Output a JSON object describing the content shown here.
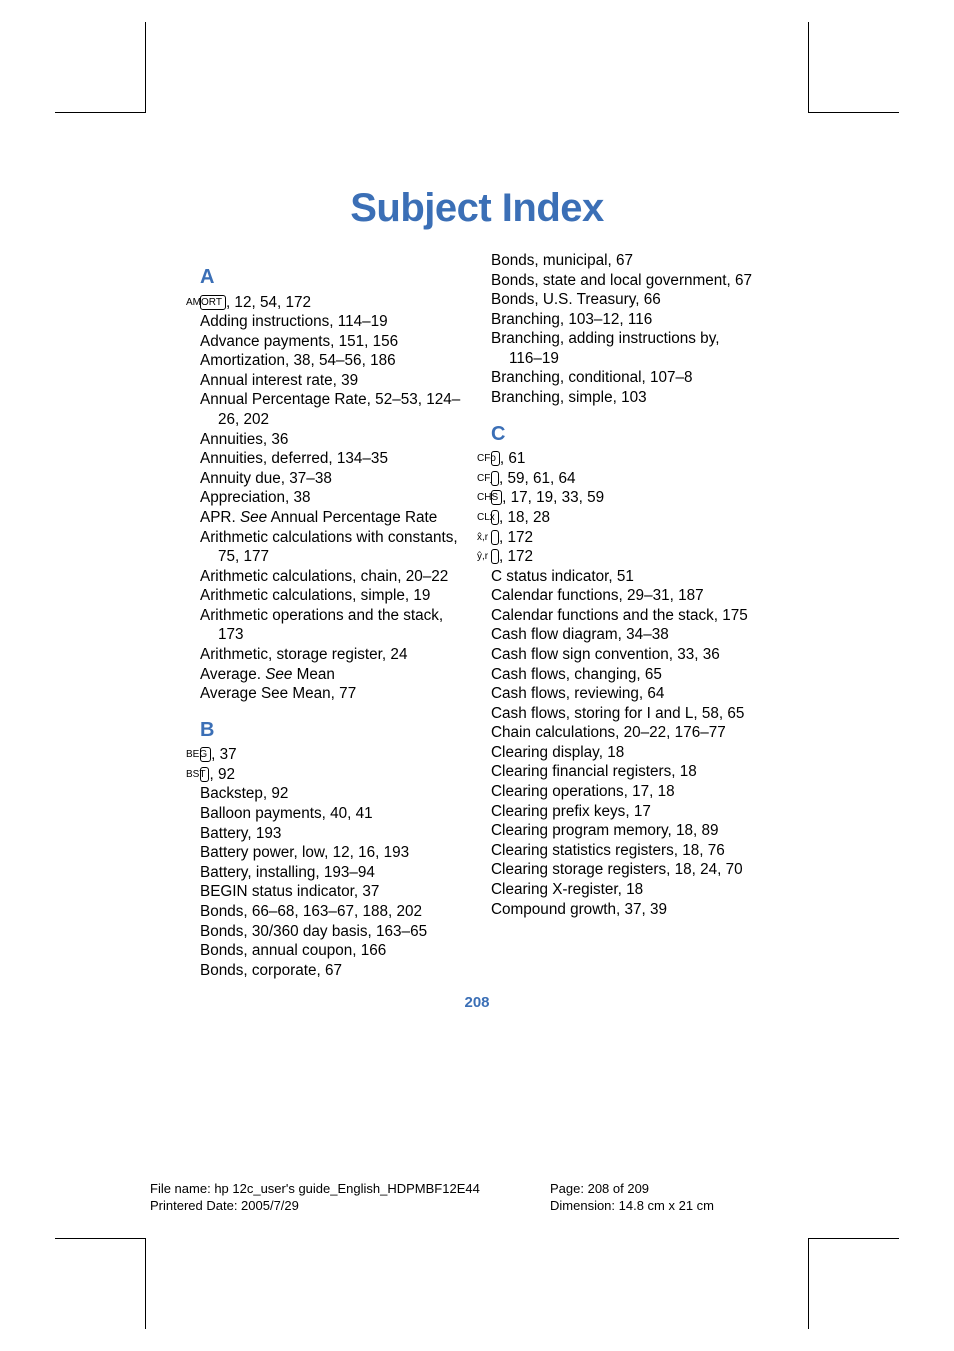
{
  "title": "Subject Index",
  "page_number": "208",
  "footer": {
    "filename_label": "File name: ",
    "filename": "hp 12c_user's guide_English_HDPMBF12E44",
    "date_label": "Printered Date: ",
    "date": "2005/7/29",
    "page_label": "Page: ",
    "page": "208 of 209",
    "dim_label": "Dimension: ",
    "dim": "14.8 cm x 21 cm"
  },
  "A": {
    "heading": "A",
    "amort_key": "AMORT",
    "amort_pages": ", 12, 54, 172",
    "e1": "Adding instructions, 114–19",
    "e2": "Advance payments, 151, 156",
    "e3": "Amortization, 38, 54–56, 186",
    "e4": "Annual interest rate, 39",
    "e5": "Annual Percentage Rate, 52–53, 124–26, 202",
    "e6": "Annuities, 36",
    "e7": "Annuities, deferred, 134–35",
    "e8": "Annuity due, 37–38",
    "e9": "Appreciation, 38",
    "e10_a": "APR. ",
    "e10_b": "See",
    "e10_c": " Annual Percentage Rate",
    "e11": "Arithmetic calculations with constants, 75, 177",
    "e12": "Arithmetic calculations, chain, 20–22",
    "e13": "Arithmetic calculations, simple, 19",
    "e14": "Arithmetic operations and the stack, 173",
    "e15": "Arithmetic, storage register, 24",
    "e16_a": "Average. ",
    "e16_b": "See",
    "e16_c": " Mean",
    "e17": "Average See Mean, 77"
  },
  "B": {
    "heading": "B",
    "beg_key": "BEG",
    "beg_pages": ", 37",
    "bst_key": "BST",
    "bst_pages": ", 92",
    "e1": "Backstep, 92",
    "e2": "Balloon payments, 40, 41",
    "e3": "Battery, 193",
    "e4": "Battery power, low, 12, 16, 193",
    "e5": "Battery, installing, 193–94",
    "e6": "BEGIN status indicator, 37",
    "e7": "Bonds, 66–68, 163–67, 188, 202",
    "e8": "Bonds, 30/360 day basis, 163–65",
    "e9": "Bonds, annual coupon, 166",
    "e10": "Bonds, corporate, 67"
  },
  "B2": {
    "e11": "Bonds, municipal, 67",
    "e12": "Bonds, state and local government, 67",
    "e13": "Bonds, U.S. Treasury, 66",
    "e14": "Branching, 103–12, 116",
    "e15": "Branching, adding instructions by, 116–19",
    "e16": "Branching, conditional, 107–8",
    "e17": "Branching, simple, 103"
  },
  "C": {
    "heading": "C",
    "cfo_key": "CFo",
    "cfo_pages": ", 61",
    "cfj_key": "CFj",
    "cfj_pages": ", 59, 61, 64",
    "chs_key": "CHS",
    "chs_pages": ", 17, 19, 33, 59",
    "clx_key": "CLx",
    "clx_pages": ", 18, 28",
    "xr_key": "x̂,r",
    "xr_pages": ", 172",
    "yr_key": "ŷ,r",
    "yr_pages": ", 172",
    "e1": "C status indicator, 51",
    "e2": "Calendar functions, 29–31, 187",
    "e3": "Calendar functions and the stack, 175",
    "e4": "Cash flow diagram, 34–38",
    "e5": "Cash flow sign convention, 33, 36",
    "e6": "Cash flows, changing, 65",
    "e7": "Cash flows, reviewing, 64",
    "e8": "Cash flows, storing for I and L, 58, 65",
    "e9": "Chain calculations, 20–22, 176–77",
    "e10": "Clearing display, 18",
    "e11": "Clearing financial registers, 18",
    "e12": "Clearing operations, 17, 18",
    "e13": "Clearing prefix keys, 17",
    "e14": "Clearing program memory, 18, 89",
    "e15": "Clearing statistics registers, 18, 76",
    "e16": "Clearing storage registers, 18, 24, 70",
    "e17": "Clearing X-register, 18",
    "e18": "Compound growth, 37, 39"
  }
}
